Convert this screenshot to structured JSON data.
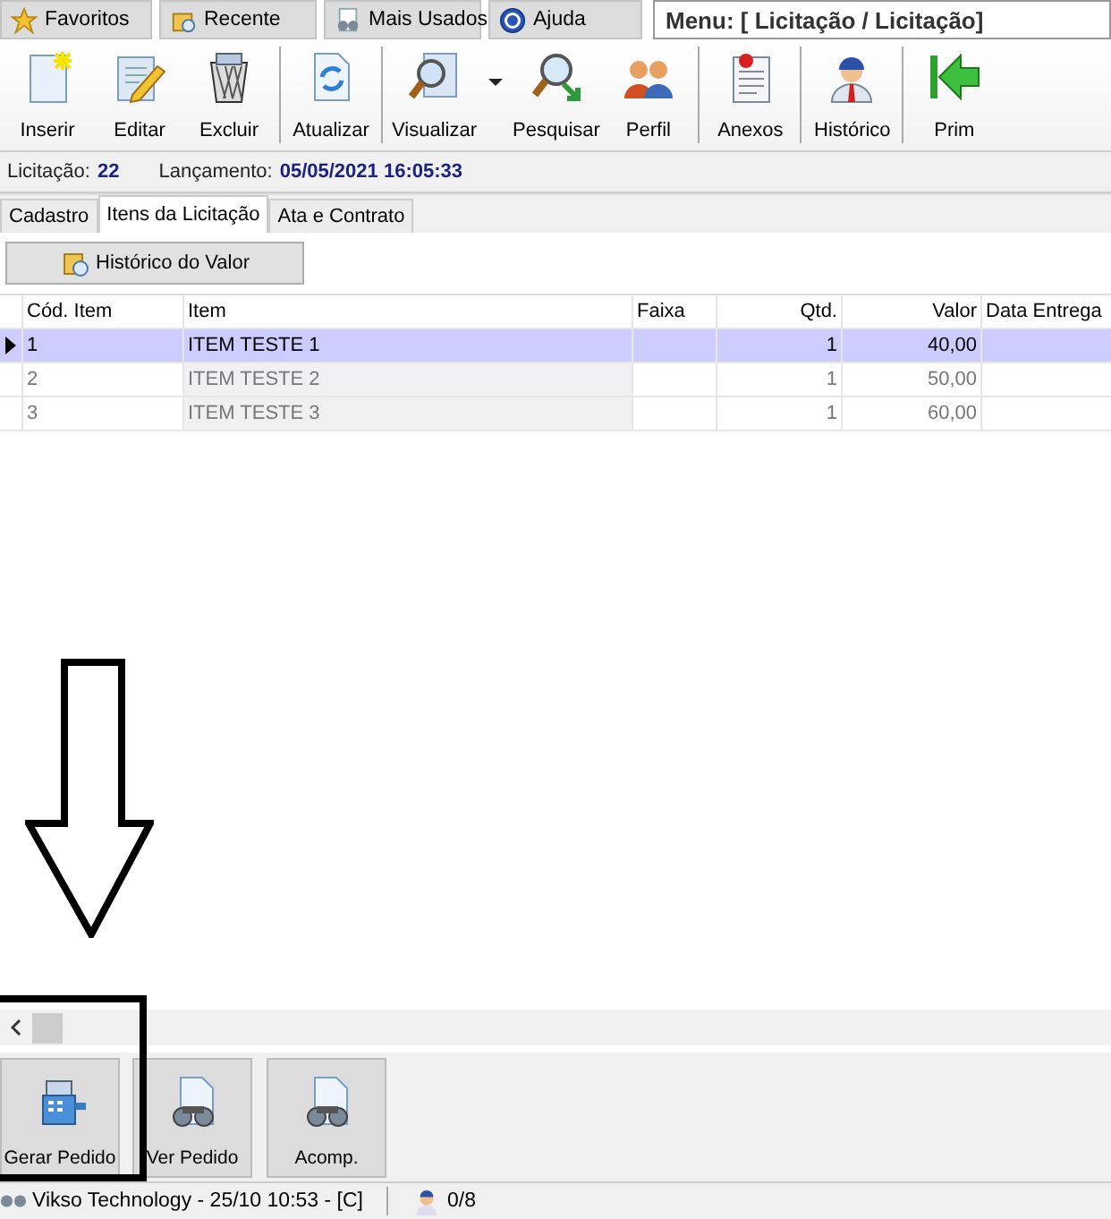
{
  "top_tabs": [
    {
      "label": "Favoritos"
    },
    {
      "label": "Recente"
    },
    {
      "label": "Mais Usados"
    },
    {
      "label": "Ajuda"
    }
  ],
  "menu_path": "Menu: [ Licitação / Licitação]",
  "toolbar": {
    "groups": [
      [
        {
          "label": "Inserir"
        },
        {
          "label": "Editar"
        },
        {
          "label": "Excluir"
        }
      ],
      [
        {
          "label": "Atualizar"
        }
      ],
      [
        {
          "label": "Visualizar",
          "dropdown": true
        },
        {
          "label": "Pesquisar"
        },
        {
          "label": "Perfil"
        }
      ],
      [
        {
          "label": "Anexos"
        }
      ],
      [
        {
          "label": "Histórico"
        }
      ],
      [
        {
          "label": "Prim"
        }
      ]
    ]
  },
  "info": [
    {
      "label": "Licitação:",
      "value": "22"
    },
    {
      "label": "Lançamento:",
      "value": "05/05/2021 16:05:33"
    }
  ],
  "tabs": [
    {
      "label": "Cadastro",
      "selected": false
    },
    {
      "label": "Itens da Licitação",
      "selected": true
    },
    {
      "label": "Ata e Contrato",
      "selected": false
    }
  ],
  "history_button": "Histórico do Valor",
  "table": {
    "columns": [
      "Cód. Item",
      "Item",
      "Faixa",
      "Qtd.",
      "Valor",
      "Data Entrega"
    ],
    "rows": [
      {
        "cells": [
          "1",
          "ITEM TESTE 1",
          "",
          "1",
          "40,00",
          ""
        ],
        "selected": true
      },
      {
        "cells": [
          "2",
          "ITEM TESTE 2",
          "",
          "1",
          "50,00",
          ""
        ],
        "selected": false
      },
      {
        "cells": [
          "3",
          "ITEM TESTE 3",
          "",
          "1",
          "60,00",
          ""
        ],
        "selected": false
      }
    ]
  },
  "actions": [
    {
      "label": "Gerar Pedido"
    },
    {
      "label": "Ver Pedido"
    },
    {
      "label": "Acomp."
    }
  ],
  "status_bar": {
    "text": "Vikso Technology - 25/10 10:53 - [C]",
    "users": "0/8"
  }
}
